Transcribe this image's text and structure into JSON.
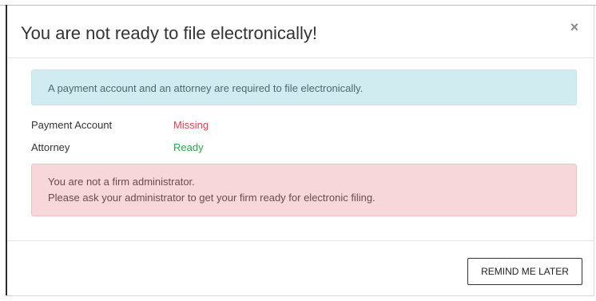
{
  "modal": {
    "title": "You are not ready to file electronically!",
    "close_label": "×",
    "info_message": "A payment account and an attorney are required to file electronically.",
    "status": [
      {
        "label": "Payment Account",
        "value": "Missing",
        "color": "#e0424f"
      },
      {
        "label": "Attorney",
        "value": "Ready",
        "color": "#28a745"
      }
    ],
    "danger_lines": [
      "You are not a firm administrator.",
      "Please ask your administrator to get your firm ready for electronic filing."
    ],
    "footer": {
      "remind_label": "REMIND ME LATER"
    }
  },
  "colors": {
    "info_bg": "#d1ecf1",
    "danger_bg": "#f8d7da",
    "missing": "#e0424f",
    "ready": "#28a745"
  }
}
